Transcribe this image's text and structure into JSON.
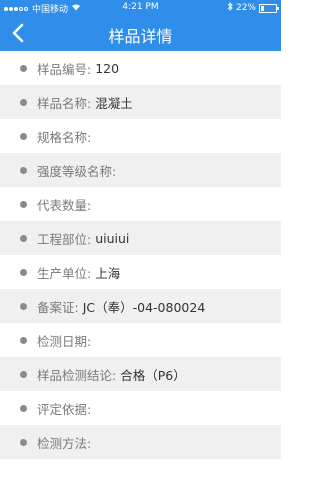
{
  "status_bar": {
    "carrier": "中国移动",
    "time": "4:21 PM",
    "battery_text": "22%",
    "battery_level": 0.22
  },
  "header": {
    "title": "样品详情"
  },
  "fields": [
    {
      "label": "样品编号:",
      "value": "120"
    },
    {
      "label": "样品名称:",
      "value": "混凝土"
    },
    {
      "label": "规格名称:",
      "value": ""
    },
    {
      "label": "强度等级名称:",
      "value": ""
    },
    {
      "label": "代表数量:",
      "value": ""
    },
    {
      "label": "工程部位:",
      "value": "uiuiui"
    },
    {
      "label": "生产单位:",
      "value": "上海"
    },
    {
      "label": "备案证:",
      "value": "JC（奉）-04-080024"
    },
    {
      "label": "检测日期:",
      "value": ""
    },
    {
      "label": "样品检测结论:",
      "value": "合格（P6）"
    },
    {
      "label": "评定依据:",
      "value": ""
    },
    {
      "label": "检测方法:",
      "value": ""
    }
  ]
}
